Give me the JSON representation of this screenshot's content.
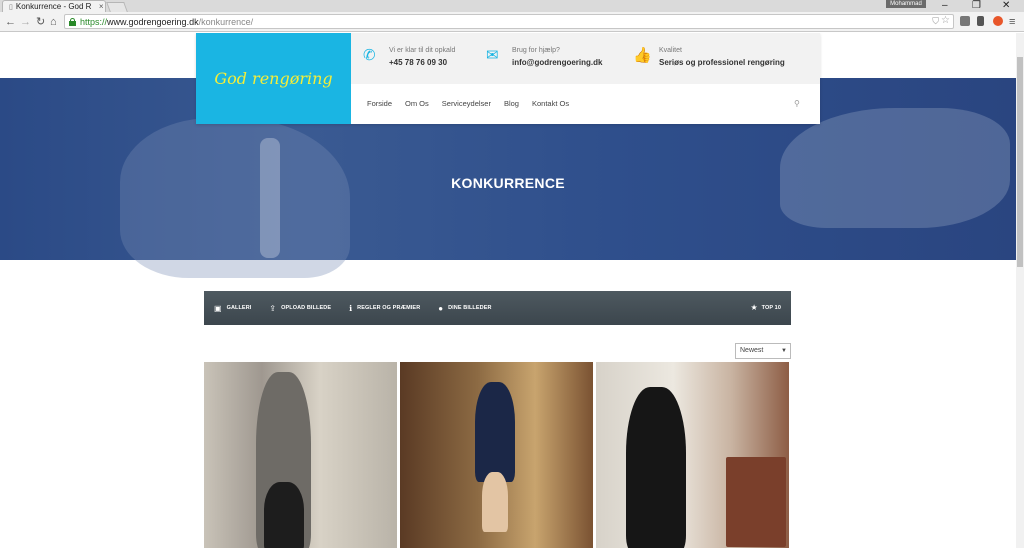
{
  "browser": {
    "tab_title": "Konkurrence - God R",
    "tab_close": "×",
    "user_badge": "Mohammad",
    "url_scheme": "https://",
    "url_host": "www.godrengoering.dk",
    "url_path": "/konkurrence/"
  },
  "header": {
    "logo_text": "God rengøring",
    "info": [
      {
        "label": "Vi er klar til dit opkald",
        "value": "+45 78 76 09 30",
        "icon": "phone-icon"
      },
      {
        "label": "Brug for hjælp?",
        "value": "info@godrengoering.dk",
        "icon": "envelope-icon"
      },
      {
        "label": "Kvalitet",
        "value": "Seriøs og professionel rengøring",
        "icon": "thumbs-up-icon"
      }
    ],
    "menu": [
      "Forside",
      "Om Os",
      "Serviceydelser",
      "Blog",
      "Kontakt Os"
    ]
  },
  "hero": {
    "title": "KONKURRENCE"
  },
  "toolbar": {
    "items": [
      "GALLERI",
      "OPLOAD BILLEDE",
      "REGLER OG PRÆMIER",
      "DINE BILLEDER"
    ],
    "right": "TOP 10"
  },
  "sort": {
    "selected": "Newest"
  },
  "colors": {
    "logo_bg": "#1ab5e3",
    "logo_text": "#f4ee3a",
    "hero_bg": "#2b4a86",
    "toolbar_bg": "#4a555c"
  }
}
